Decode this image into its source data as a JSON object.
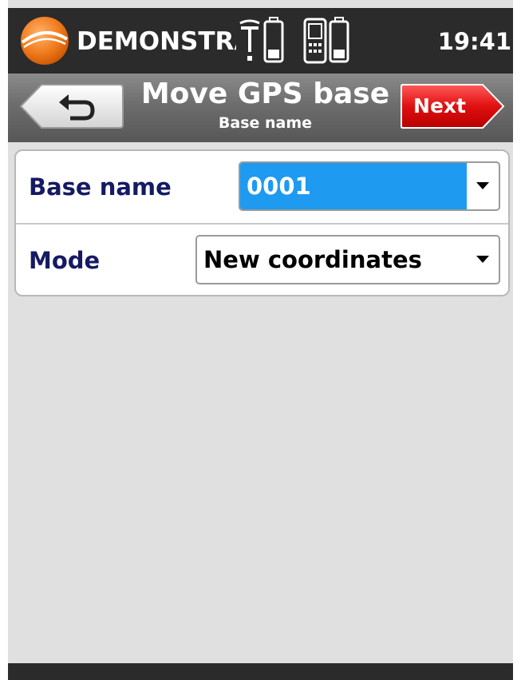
{
  "status_bar": {
    "app_name": "DEMONSTRACJA",
    "time": "19:41",
    "icons": [
      "logo-icon",
      "gps-antenna-icon",
      "antenna-battery-icon",
      "controller-icon",
      "controller-battery-icon"
    ]
  },
  "title_bar": {
    "title": "Move GPS base",
    "subtitle": "Base name",
    "back_icon": "back-arrow-icon",
    "next_label": "Next"
  },
  "form": {
    "fields": [
      {
        "label": "Base name",
        "value": "0001",
        "highlighted": true
      },
      {
        "label": "Mode",
        "value": "New coordinates",
        "highlighted": false
      }
    ]
  },
  "colors": {
    "label_text": "#151a63",
    "selection": "#1e9af0",
    "next_button": "#e01010",
    "header_dark": "#2b2b2b"
  }
}
